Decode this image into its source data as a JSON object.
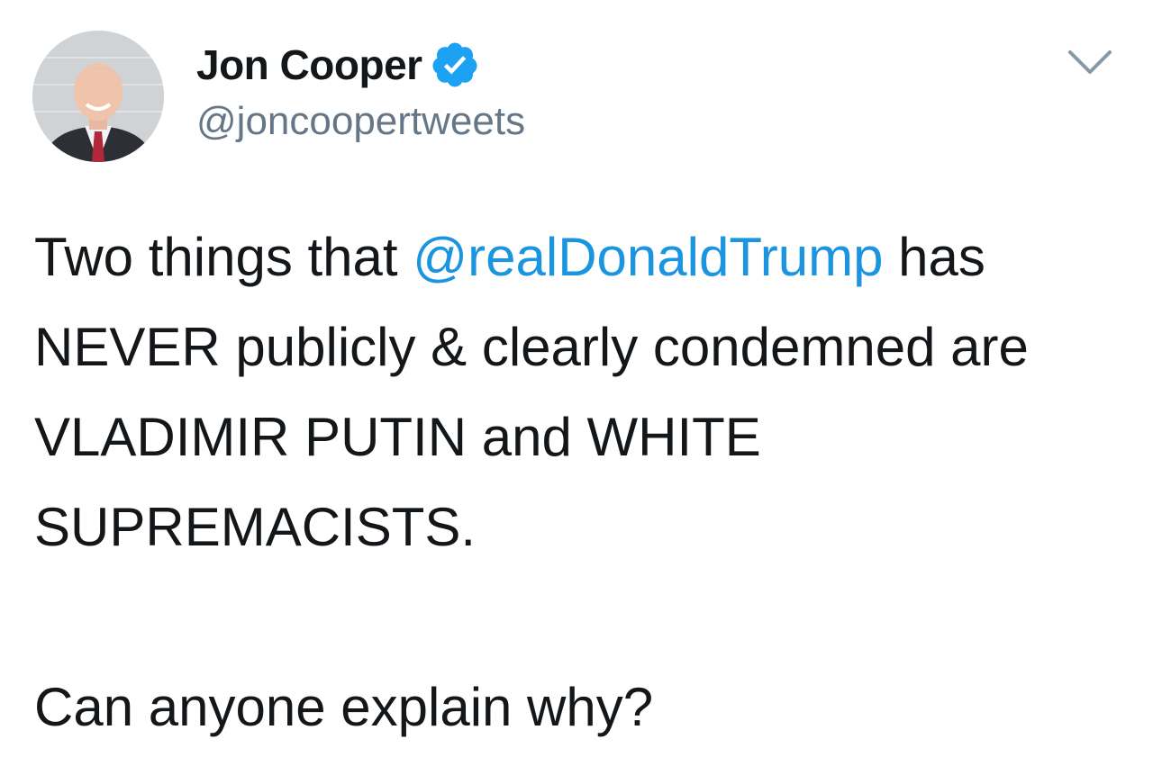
{
  "author": {
    "display_name": "Jon Cooper",
    "handle": "@joncoopertweets",
    "verified": true,
    "verified_color": "#1da1f2"
  },
  "tweet": {
    "text_before_mention": "Two things that ",
    "mention": "@realDonaldTrump",
    "text_after_mention": " has NEVER publicly & clearly condemned are VLADIMIR PUTIN and WHITE SUPREMACISTS.",
    "second_paragraph": "Can anyone explain why?",
    "mention_color": "#1b95e0"
  },
  "icons": {
    "menu": "chevron-down-icon",
    "badge": "verified-badge-icon"
  }
}
